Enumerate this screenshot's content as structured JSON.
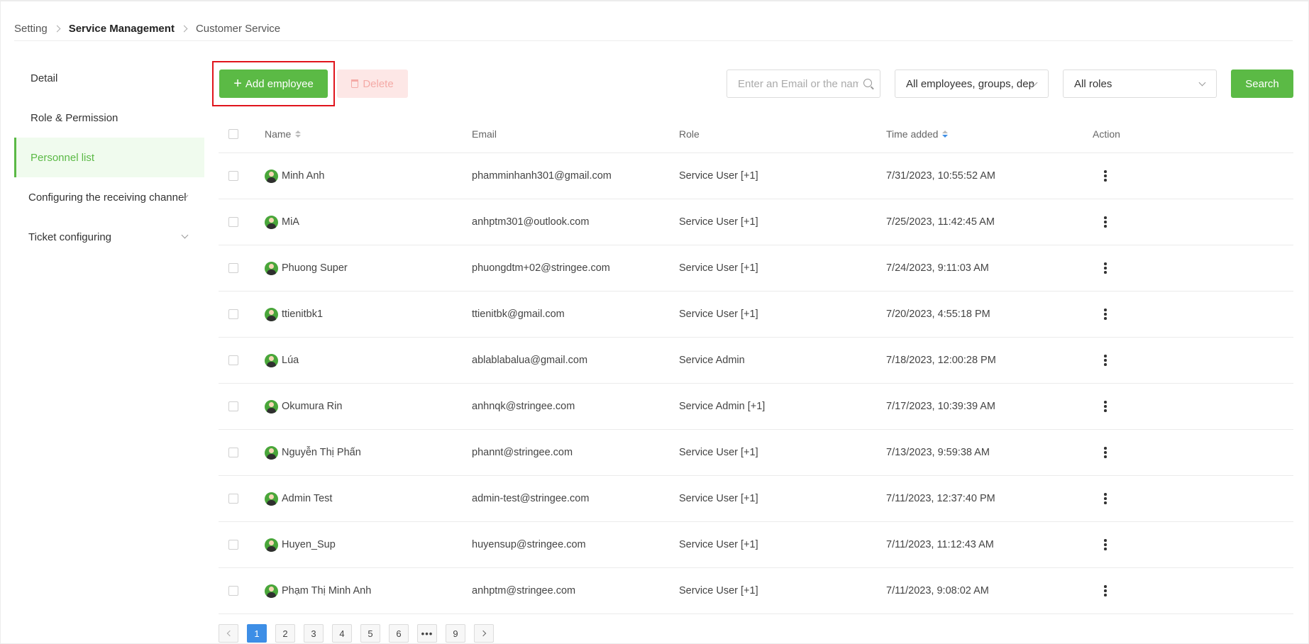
{
  "breadcrumb": {
    "items": [
      "Setting",
      "Service Management",
      "Customer Service"
    ]
  },
  "sidebar": {
    "items": [
      {
        "label": "Detail"
      },
      {
        "label": "Role & Permission"
      },
      {
        "label": "Personnel list"
      },
      {
        "label": "Configuring the receiving channel"
      },
      {
        "label": "Ticket configuring"
      }
    ]
  },
  "toolbar": {
    "add_label": "Add employee",
    "delete_label": "Delete",
    "search_placeholder": "Enter an Email or the name",
    "employees_filter": "All employees, groups, dep",
    "roles_filter": "All roles",
    "search_label": "Search"
  },
  "table": {
    "headers": {
      "name": "Name",
      "email": "Email",
      "role": "Role",
      "time": "Time added",
      "action": "Action"
    },
    "rows": [
      {
        "name": "Minh Anh",
        "email": "phamminhanh301@gmail.com",
        "role": "Service User [+1]",
        "time": "7/31/2023, 10:55:52 AM"
      },
      {
        "name": "MiA",
        "email": "anhptm301@outlook.com",
        "role": "Service User [+1]",
        "time": "7/25/2023, 11:42:45 AM"
      },
      {
        "name": "Phuong Super",
        "email": "phuongdtm+02@stringee.com",
        "role": "Service User [+1]",
        "time": "7/24/2023, 9:11:03 AM"
      },
      {
        "name": "ttienitbk1",
        "email": "ttienitbk@gmail.com",
        "role": "Service User [+1]",
        "time": "7/20/2023, 4:55:18 PM"
      },
      {
        "name": "Lúa",
        "email": "ablablabalua@gmail.com",
        "role": "Service Admin",
        "time": "7/18/2023, 12:00:28 PM"
      },
      {
        "name": "Okumura Rin",
        "email": "anhnqk@stringee.com",
        "role": "Service Admin [+1]",
        "time": "7/17/2023, 10:39:39 AM"
      },
      {
        "name": "Nguyễn Thị Phấn",
        "email": "phannt@stringee.com",
        "role": "Service User [+1]",
        "time": "7/13/2023, 9:59:38 AM"
      },
      {
        "name": "Admin Test",
        "email": "admin-test@stringee.com",
        "role": "Service User [+1]",
        "time": "7/11/2023, 12:37:40 PM"
      },
      {
        "name": "Huyen_Sup",
        "email": "huyensup@stringee.com",
        "role": "Service User [+1]",
        "time": "7/11/2023, 11:12:43 AM"
      },
      {
        "name": "Phạm Thị Minh Anh",
        "email": "anhptm@stringee.com",
        "role": "Service User [+1]",
        "time": "7/11/2023, 9:08:02 AM"
      }
    ]
  },
  "pagination": {
    "pages": [
      "1",
      "2",
      "3",
      "4",
      "5",
      "6",
      "•••",
      "9"
    ],
    "current": "1"
  },
  "colors": {
    "accent": "#5bba45",
    "active_page": "#3d8ee6",
    "highlight": "#e0141c",
    "delete_bg": "#fde7e6"
  }
}
